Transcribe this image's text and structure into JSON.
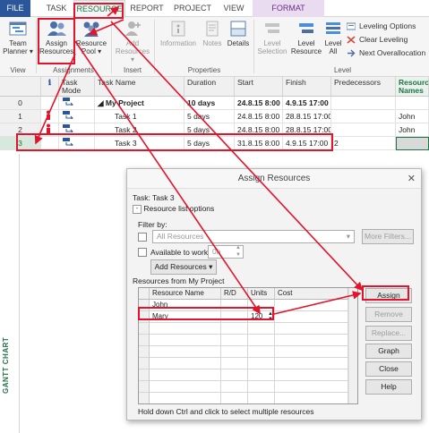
{
  "tabs": [
    "FILE",
    "TASK",
    "RESOURCE",
    "REPORT",
    "PROJECT",
    "VIEW",
    "FORMAT"
  ],
  "ribbon": {
    "team_planner": "Team Planner",
    "team_planner_arrow": "▾",
    "assign_resources": "Assign Resources",
    "resource_pool": "Resource Pool",
    "resource_pool_arrow": "▾",
    "add_resources": "Add Resources",
    "add_resources_arrow": "▾",
    "information": "Information",
    "notes": "Notes",
    "details": "Details",
    "level_selection": "Level Selection",
    "level_resource": "Level Resource",
    "level_all": "Level All",
    "leveling_options": "Leveling Options",
    "clear_leveling": "Clear Leveling",
    "next_overallocation": "Next Overallocation",
    "group_view": "View",
    "group_assignments": "Assignments",
    "group_insert": "Insert",
    "group_properties": "Properties",
    "group_level": "Level"
  },
  "grid": {
    "headers": {
      "info": "ℹ",
      "task_mode": "Task Mode",
      "task_name": "Task Name",
      "duration": "Duration",
      "start": "Start",
      "finish": "Finish",
      "predecessors": "Predecessors",
      "resource_names": "Resource Names"
    },
    "rows": [
      {
        "num": "0",
        "name": "My Project",
        "duration": "10 days",
        "start": "24.8.15 8:00",
        "finish": "4.9.15 17:00",
        "pred": "",
        "res": ""
      },
      {
        "num": "1",
        "name": "Task 1",
        "duration": "5 days",
        "start": "24.8.15 8:00",
        "finish": "28.8.15 17:00",
        "pred": "",
        "res": "John"
      },
      {
        "num": "2",
        "name": "Task 2",
        "duration": "5 days",
        "start": "24.8.15 8:00",
        "finish": "28.8.15 17:00",
        "pred": "",
        "res": "John"
      },
      {
        "num": "3",
        "name": "Task 3",
        "duration": "5 days",
        "start": "31.8.15 8:00",
        "finish": "4.9.15 17:00",
        "pred": "2",
        "res": ""
      }
    ],
    "gantt_label": "GANTT CHART"
  },
  "dialog": {
    "title": "Assign Resources",
    "close": "✕",
    "task_label": "Task: Task 3",
    "list_options": "Resource list options",
    "filter_by": "Filter by:",
    "filter_value": "All Resources",
    "more_filters": "More Filters...",
    "available_to_work": "Available to work",
    "available_hours": "0h",
    "add_resources": "Add Resources",
    "resources_from": "Resources from My Project",
    "columns": {
      "name": "Resource Name",
      "rd": "R/D",
      "units": "Units",
      "cost": "Cost"
    },
    "resources": [
      {
        "name": "John",
        "rd": "",
        "units": "",
        "cost": ""
      },
      {
        "name": "Mary",
        "rd": "",
        "units": "120",
        "cost": ""
      }
    ],
    "buttons": {
      "assign": "Assign",
      "remove": "Remove",
      "replace": "Replace...",
      "graph": "Graph",
      "close": "Close",
      "help": "Help"
    },
    "hint": "Hold down Ctrl and click to select multiple resources"
  },
  "colors": {
    "accent_green": "#217346",
    "file_tab": "#2b579a",
    "annotation_red": "#e3132b"
  }
}
